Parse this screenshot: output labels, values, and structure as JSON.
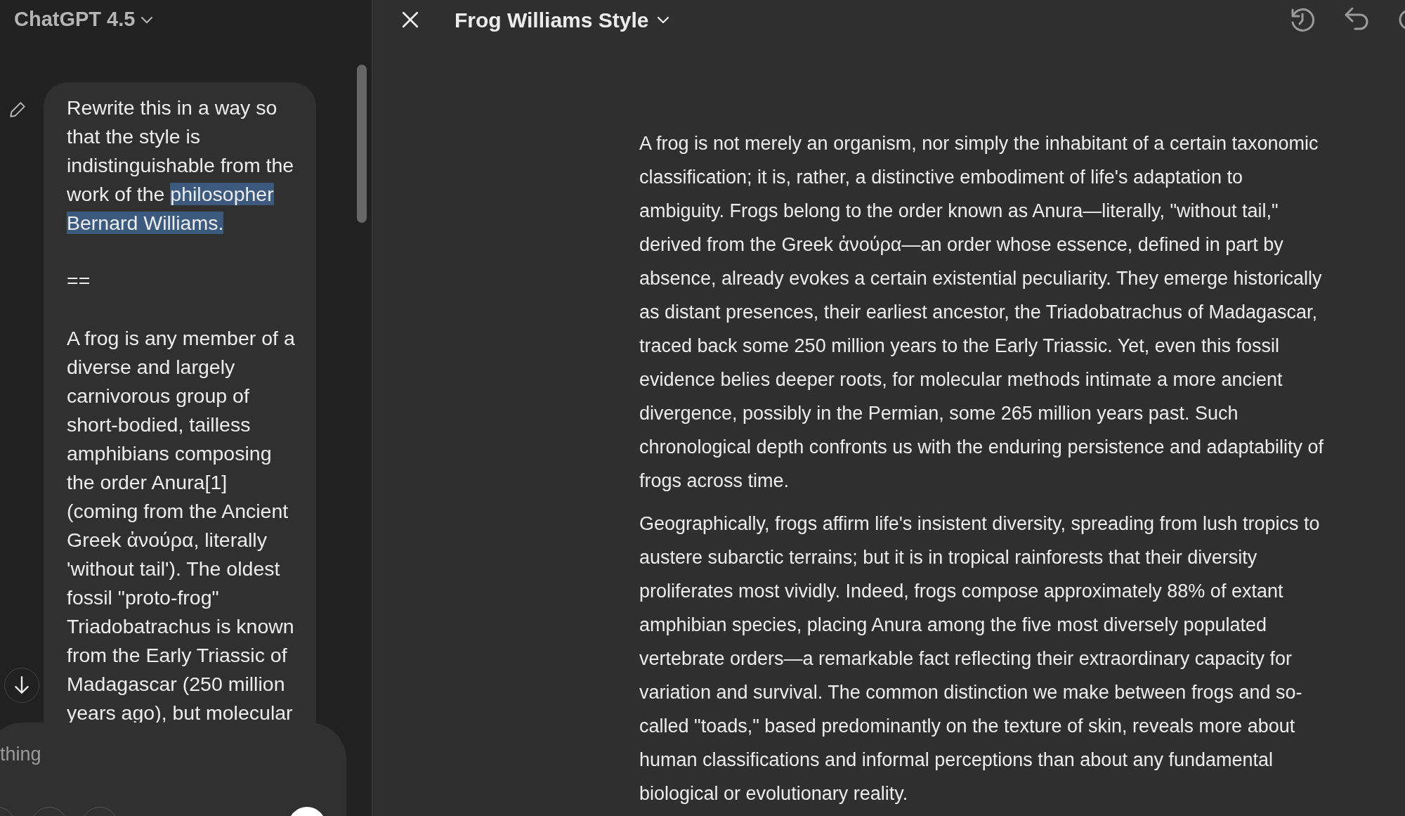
{
  "chat_panel": {
    "model_title": "ChatGPT 4.5",
    "message": {
      "request_before": "Rewrite this in a way so that the style is indistinguishable from the work of the ",
      "request_highlighted": "philosopher Bernard Williams.",
      "separator": "==",
      "source": "A frog is any member of a diverse and largely carnivorous group of short-bodied, tailless amphibians composing the order Anura[1] (coming from the Ancient Greek ἀνούρα, literally 'without tail'). The oldest fossil \"proto-frog\" Triadobatrachus is known from the Early Triassic of Madagascar (250 million years ago), but molecular"
    },
    "composer": {
      "placeholder": "thing"
    }
  },
  "canvas": {
    "title": "Frog Williams Style",
    "paragraphs": [
      "A frog is not merely an organism, nor simply the inhabitant of a certain taxonomic classification; it is, rather, a distinctive embodiment of life's adaptation to ambiguity. Frogs belong to the order known as Anura—literally, \"without tail,\" derived from the Greek ἀνούρα—an order whose essence, defined in part by absence, already evokes a certain existential peculiarity. They emerge historically as distant presences, their earliest ancestor, the Triadobatrachus of Madagascar, traced back some 250 million years to the Early Triassic. Yet, even this fossil evidence belies deeper roots, for molecular methods intimate a more ancient divergence, possibly in the Permian, some 265 million years past. Such chronological depth confronts us with the enduring persistence and adaptability of frogs across time.",
      "Geographically, frogs affirm life's insistent diversity, spreading from lush tropics to austere subarctic terrains; but it is in tropical rainforests that their diversity proliferates most vividly. Indeed, frogs compose approximately 88% of extant amphibian species, placing Anura among the five most diversely populated vertebrate orders—a remarkable fact reflecting their extraordinary capacity for variation and survival. The common distinction we make between frogs and so-called \"toads,\" based predominantly on the texture of skin, reveals more about human classifications and informal perceptions than about any fundamental biological or evolutionary reality."
    ]
  }
}
